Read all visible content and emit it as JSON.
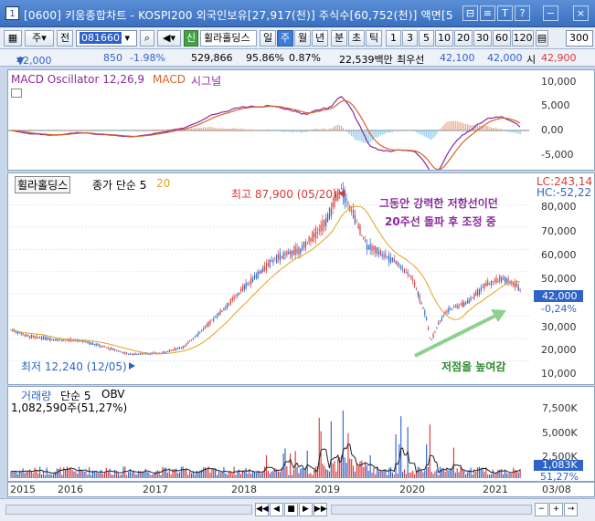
{
  "window": {
    "num": "1",
    "title": "[0600] 키움종합차트 - KOSPI200 외국인보유[27,917(천)] 주식수[60,752(천)] 액면[5"
  },
  "title_buttons": [
    "⊟",
    "≡",
    "T",
    "?",
    "−",
    "×"
  ],
  "toolbar": {
    "type": "주",
    "prev": "전",
    "code": "081660",
    "stock_badge": "신",
    "stock_name": "휠라홀딩스",
    "periods": [
      "일",
      "주",
      "월",
      "년",
      "분",
      "초",
      "틱"
    ],
    "active_period": "주",
    "intervals": [
      "1",
      "3",
      "5",
      "10",
      "20",
      "30",
      "60",
      "120"
    ],
    "count": "300"
  },
  "quote": {
    "price": "42,000",
    "arrow": "▼",
    "change": "850",
    "change_pct": "-1.98%",
    "volume": "529,866",
    "vol_ratio": "95.86%",
    "turnover": "0.87%",
    "amount": "22,539백만",
    "sell_label": "최우선",
    "best_ask": "42,100",
    "best_bid": "42,000",
    "open_label": "시",
    "open": "42,900"
  },
  "macd": {
    "label": "MACD Oscillator 12,26,9",
    "label2": "MACD",
    "label3": "시그널",
    "axis": [
      "10,000",
      "5,000",
      "0,00",
      "-5,000"
    ]
  },
  "price": {
    "name": "휠라홀딩스",
    "ma_label": "종가 단순 5",
    "ma_val": "20",
    "lc": "LC:243,14",
    "hc": "HC:-52,22",
    "high_note": "최고 87,900 (05/20)",
    "low_note": "최저 12,240 (12/05)",
    "resist_note": [
      "그동안 강력한 저항선이던",
      "20주선 돌파 후 조정 중"
    ],
    "uptrend_note": "저점을 높여감",
    "current": "42,000",
    "current_pct": "-0,24%",
    "axis": [
      "80,000",
      "70,000",
      "60,000",
      "50,000",
      "40,000",
      "30,000",
      "20,000",
      "10,000"
    ]
  },
  "volume": {
    "label": "거래량",
    "ma": "단순 5",
    "obv": "OBV",
    "amount": "1,082,590주(51,27%)",
    "axis": [
      "7,500K",
      "5,000K",
      "2,500K"
    ],
    "current": "1,083K",
    "current_pct": "51,27%"
  },
  "xaxis": [
    "2015",
    "2016",
    "2017",
    "2018",
    "2019",
    "2020",
    "2021"
  ],
  "xaxis_right": "03/08",
  "colors": {
    "up": "#d83a3a",
    "down": "#2f63c8",
    "ma5": "#c0302a",
    "ma20": "#e2a21c",
    "macd": "#8a2a9a",
    "signal": "#d6622a",
    "obv": "#222222"
  },
  "icons": [
    "grid-icon",
    "play-icon",
    "stop-icon",
    "zoom-in-icon",
    "zoom-out-icon"
  ]
}
